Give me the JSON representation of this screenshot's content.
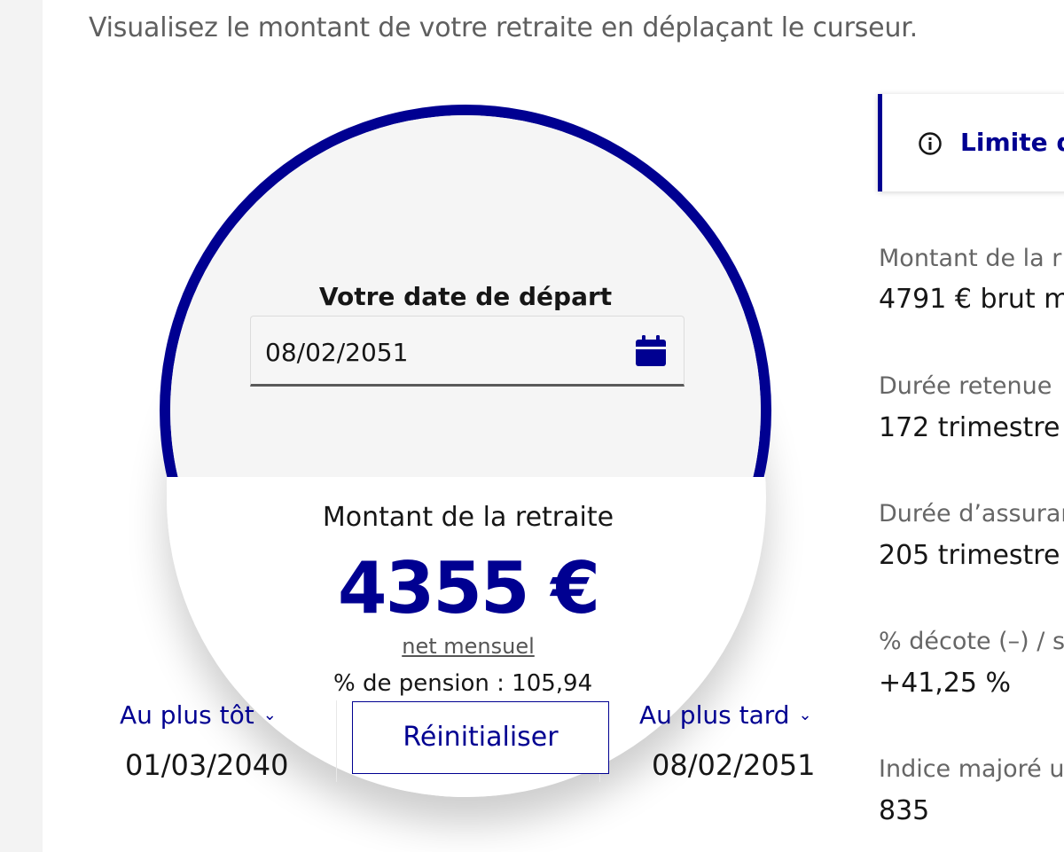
{
  "intro_text": "Visualisez le montant de votre retraite en déplaçant le curseur.",
  "gauge": {
    "ring_color": "#000091",
    "date_label": "Votre date de départ",
    "date_value": "08/02/2051",
    "amount_title": "Montant de la retraite",
    "amount_value": "4355 €",
    "amount_period": "net mensuel",
    "pension_rate": "% de pension : 105,94",
    "calendar_icon": "calendar-icon"
  },
  "range": {
    "earliest_label": "Au plus tôt",
    "earliest_date": "01/03/2040",
    "latest_label": "Au plus tard",
    "latest_date": "08/02/2051",
    "reset_label": "Réinitialiser",
    "chevron_glyph": "⌄"
  },
  "notice": {
    "icon": "info-icon",
    "title": "Limite d’"
  },
  "details": [
    {
      "label": "Montant de la r",
      "value": "4791 € brut m"
    },
    {
      "label": "Durée retenue",
      "value": "172 trimestre"
    },
    {
      "label": "Durée d’assuran",
      "value": "205 trimestre"
    },
    {
      "label": "% décote (–) / s",
      "value": "+41,25 %"
    },
    {
      "label": "Indice majoré u",
      "value": "835"
    }
  ],
  "colors": {
    "accent": "#000091",
    "text": "#161616",
    "muted": "#666666"
  }
}
